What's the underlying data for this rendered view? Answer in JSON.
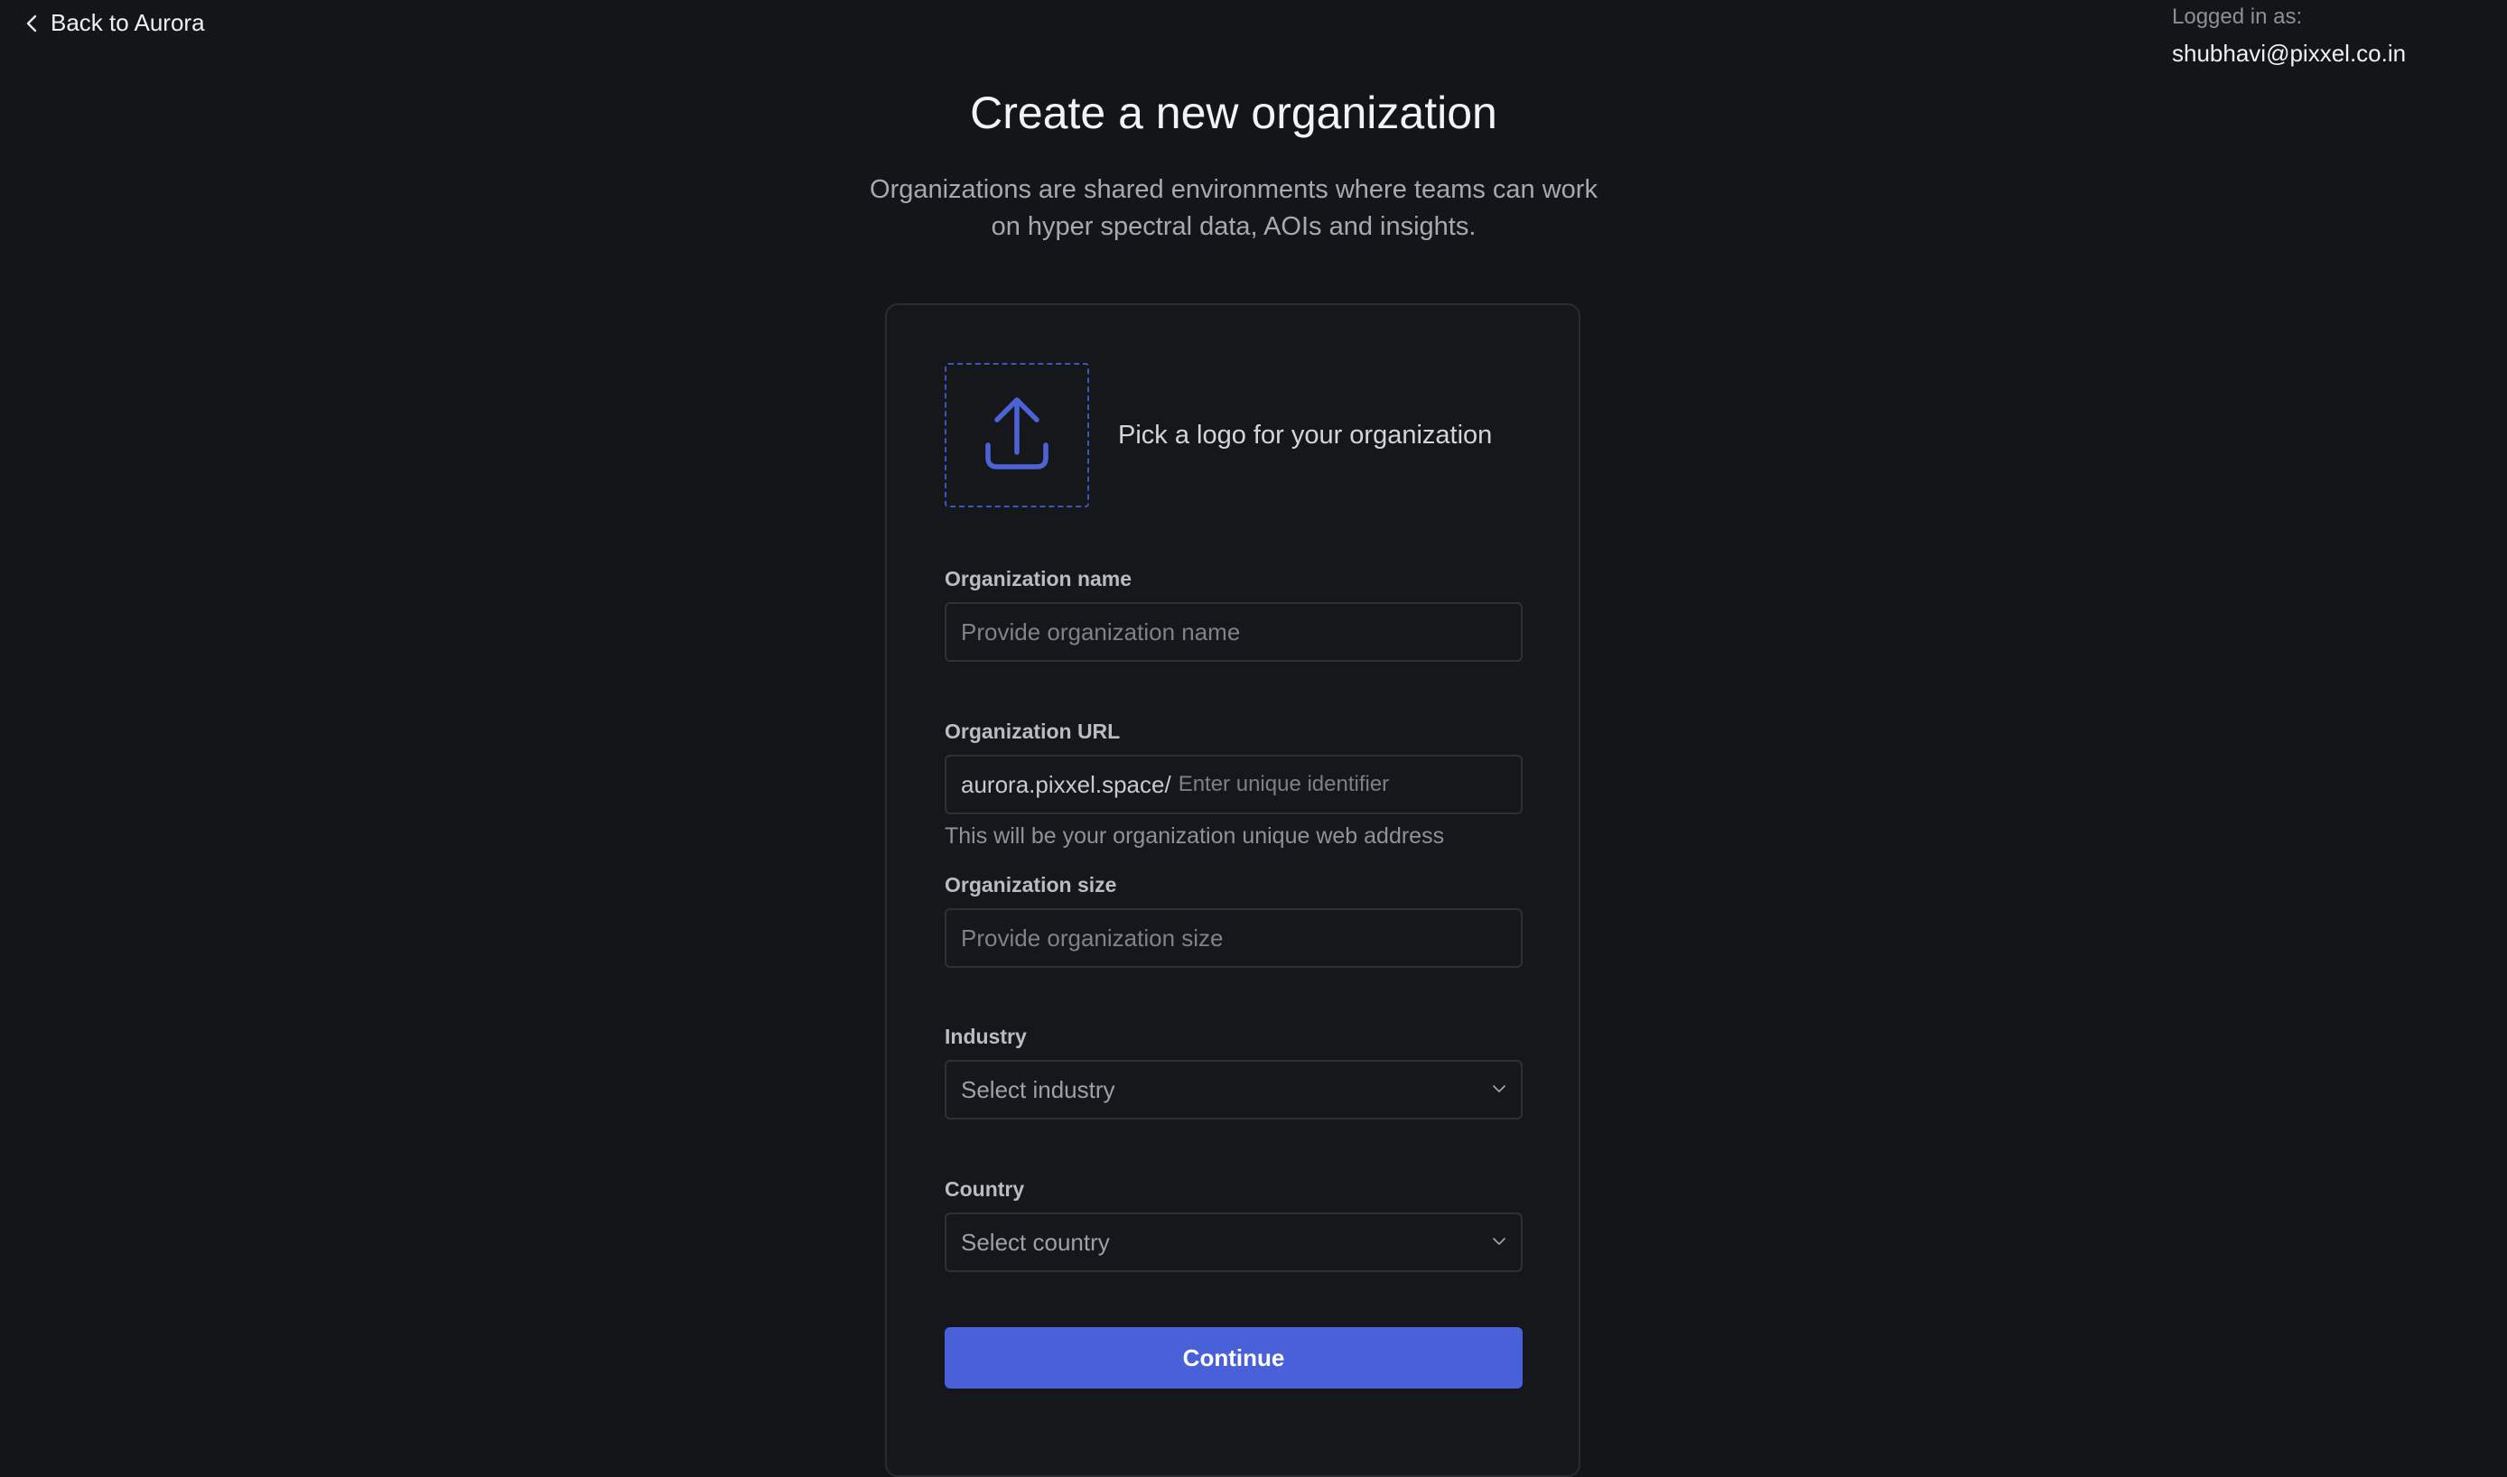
{
  "header": {
    "back_label": "Back to Aurora",
    "logged_in_label": "Logged in as:",
    "logged_in_email": "shubhavi@pixxel.co.in"
  },
  "page": {
    "title": "Create a new organization",
    "subtitle": "Organizations are shared environments where teams can work on hyper spectral data, AOIs and insights."
  },
  "form": {
    "logo": {
      "caption": "Pick a logo for your organization",
      "icon": "upload-icon"
    },
    "org_name": {
      "label": "Organization name",
      "value": "",
      "placeholder": "Provide organization name"
    },
    "org_url": {
      "label": "Organization URL",
      "prefix": "aurora.pixxel.space/",
      "value": "",
      "placeholder": "Enter unique identifier",
      "help": "This will be your organization unique web address"
    },
    "org_size": {
      "label": "Organization size",
      "value": "",
      "placeholder": "Provide organization size"
    },
    "industry": {
      "label": "Industry",
      "selected": "Select industry"
    },
    "country": {
      "label": "Country",
      "selected": "Select country"
    },
    "continue_label": "Continue"
  },
  "colors": {
    "background": "#141518",
    "accent": "#4a60d8",
    "upload_icon": "#4b63d6"
  }
}
